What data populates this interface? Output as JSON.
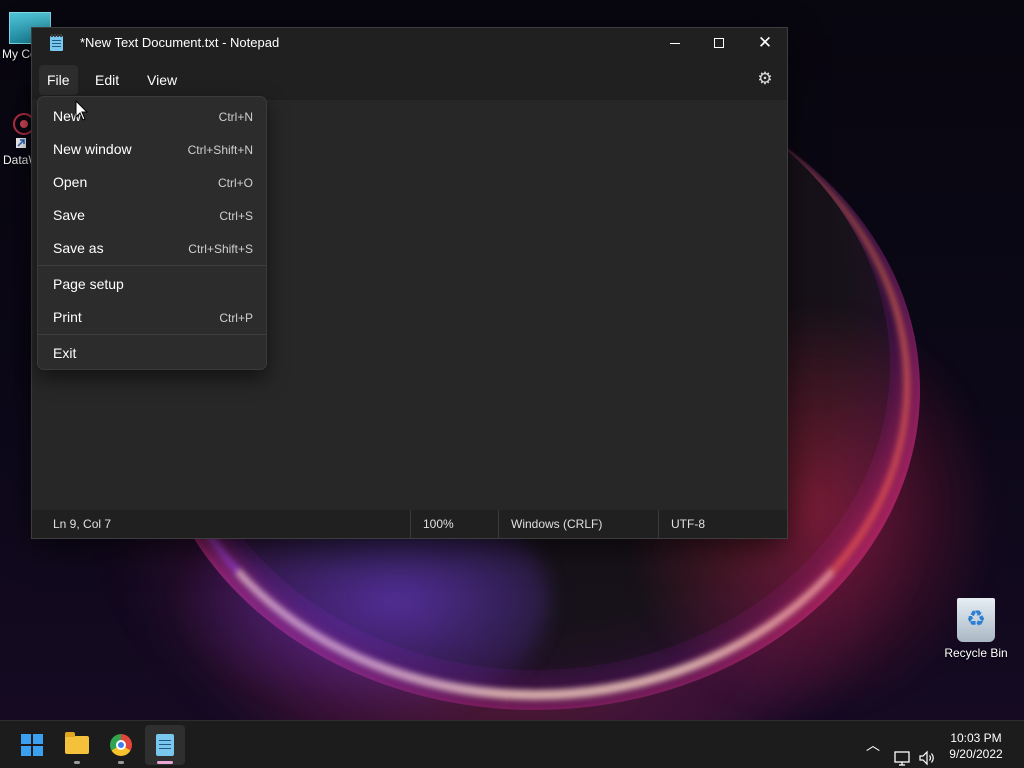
{
  "desktop": {
    "icons": [
      {
        "label": "My Co",
        "icon": "monitor-icon"
      },
      {
        "label": "DataW",
        "icon": "app-shortcut-icon"
      },
      {
        "label": "Recycle Bin",
        "icon": "recycle-bin-icon"
      }
    ]
  },
  "window": {
    "title": "*New Text Document.txt - Notepad",
    "controls": {
      "minimize": "minimize-icon",
      "maximize": "maximize-icon",
      "close": "close-icon"
    }
  },
  "menubar": {
    "items": [
      "File",
      "Edit",
      "View"
    ],
    "settings_icon": "gear-icon"
  },
  "file_menu": {
    "items": [
      {
        "label": "New",
        "shortcut": "Ctrl+N"
      },
      {
        "label": "New window",
        "shortcut": "Ctrl+Shift+N"
      },
      {
        "label": "Open",
        "shortcut": "Ctrl+O"
      },
      {
        "label": "Save",
        "shortcut": "Ctrl+S"
      },
      {
        "label": "Save as",
        "shortcut": "Ctrl+Shift+S"
      },
      {
        "label": "Page setup",
        "shortcut": ""
      },
      {
        "label": "Print",
        "shortcut": "Ctrl+P"
      },
      {
        "label": "Exit",
        "shortcut": ""
      }
    ]
  },
  "statusbar": {
    "position": "Ln 9, Col 7",
    "zoom": "100%",
    "line_ending": "Windows (CRLF)",
    "encoding": "UTF-8"
  },
  "taskbar": {
    "apps": [
      "start-icon",
      "file-explorer-icon",
      "chrome-icon",
      "notepad-icon"
    ],
    "clock": {
      "time": "10:03 PM",
      "date": "9/20/2022"
    }
  },
  "colors": {
    "window_bg": "#272727",
    "titlebar_bg": "#202020",
    "menu_bg": "#2c2c2c",
    "taskbar_bg": "#1c1c1c",
    "accent": "#3aa0f0"
  }
}
